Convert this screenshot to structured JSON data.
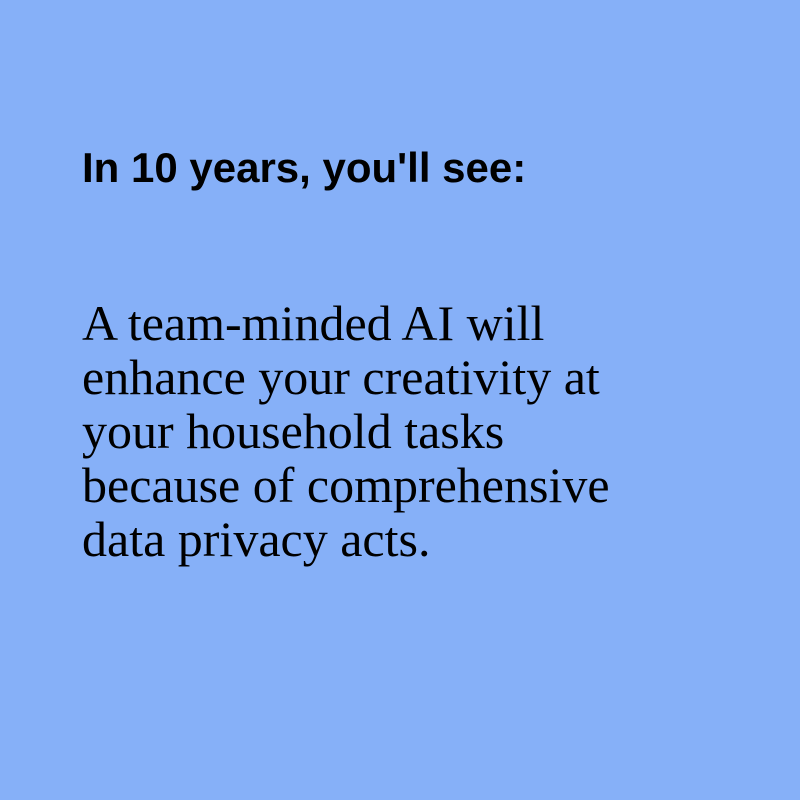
{
  "card": {
    "background_color": "#86b0f8",
    "text_color": "#000000",
    "headline": "In 10 years, you'll see:",
    "body_lines": [
      "A team-minded AI will",
      "enhance your creativity at",
      "your household tasks",
      "because of comprehensive",
      "data privacy acts."
    ]
  }
}
